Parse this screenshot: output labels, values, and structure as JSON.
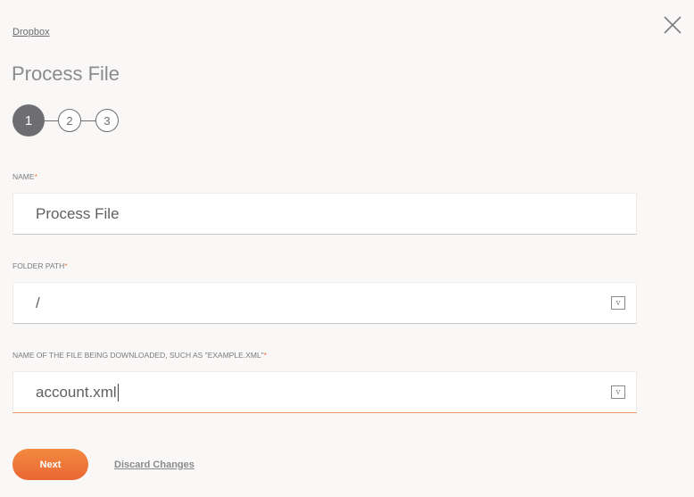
{
  "breadcrumb": "Dropbox",
  "title": "Process File",
  "steps": [
    "1",
    "2",
    "3"
  ],
  "current_step": 1,
  "fields": [
    {
      "label": "NAME",
      "required": "*",
      "value": "Process File"
    },
    {
      "label": "FOLDER PATH",
      "required": "*",
      "value": "/",
      "variable_icon": "v"
    },
    {
      "label": "NAME OF THE FILE BEING DOWNLOADED, SUCH AS \"EXAMPLE.XML\"",
      "required": "*",
      "value": "account.xml",
      "variable_icon": "v"
    }
  ],
  "buttons": {
    "next": "Next",
    "discard": "Discard Changes"
  },
  "colors": {
    "accent": "#f0763a",
    "step_active": "#6d6d72"
  }
}
